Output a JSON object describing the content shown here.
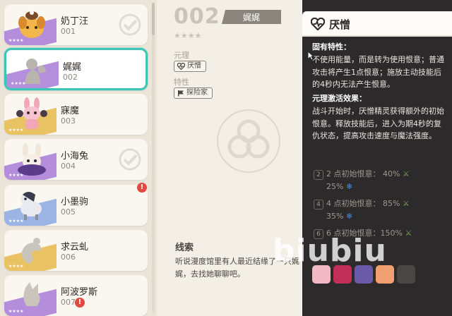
{
  "list": {
    "cards": [
      {
        "name": "奶丁汪",
        "num": "001",
        "stars": "★★★★",
        "band": "#a77bd6",
        "selected": false
      },
      {
        "name": "娓娓",
        "num": "002",
        "stars": "★★★★",
        "band": "#a77bd6",
        "selected": true
      },
      {
        "name": "寐魔",
        "num": "003",
        "stars": "★★★★",
        "band": "#e5b94a",
        "selected": false
      },
      {
        "name": "小海兔",
        "num": "004",
        "stars": "★★★★",
        "band": "#a77bd6",
        "selected": false
      },
      {
        "name": "小墨驹",
        "num": "005",
        "stars": "★★★★",
        "band": "#8aa8e0",
        "selected": false
      },
      {
        "name": "求云虬",
        "num": "006",
        "stars": "★★★★",
        "band": "#e5b94a",
        "selected": false
      },
      {
        "name": "阿波罗斯",
        "num": "007",
        "stars": "★★★★",
        "band": "#a77bd6",
        "selected": false
      }
    ]
  },
  "detail": {
    "number": "002",
    "name": "娓娓",
    "stars": "★★★★",
    "element_label": "元理",
    "element_chip": "厌憎",
    "trait_label": "特性",
    "trait_chip": "探险家",
    "clue_title": "线索",
    "clue_text": "听说漫度馆里有人最近结缘了一只娓娓，去找她聊聊吧。"
  },
  "panel": {
    "title": "厌憎",
    "innate_title": "固有特性：",
    "innate_text": "不使用能量，而是转为使用恨意；普通攻击将产生1点恨意；施放主动技能后的4秒内无法产生恨意。",
    "activate_title": "元理激活效果：",
    "activate_text": "战斗开始时，厌憎精灵获得额外的初始恨意。释放技能后，进入为期4秒的复仇状态，提高攻击速度与魔法强度。",
    "levels": [
      {
        "n": "2",
        "line1": "2 点初始恨意： 40%",
        "line2": "25%"
      },
      {
        "n": "4",
        "line1": "4 点初始恨意： 85%",
        "line2": "35%"
      },
      {
        "n": "6",
        "line1": "6 点初始恨意：150%",
        "line2": ""
      }
    ]
  },
  "watermark": "biubiu"
}
